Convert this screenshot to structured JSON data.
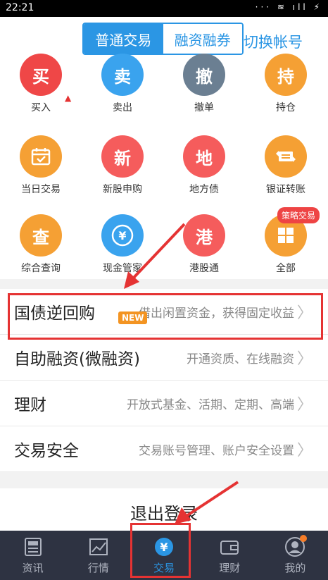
{
  "status_bar": {
    "time": "22:21",
    "icons": "··· ≋ ıll ⚡"
  },
  "header": {
    "tab_normal": "普通交易",
    "tab_margin": "融资融券",
    "switch_account": "切换帐号"
  },
  "grid": {
    "items": [
      {
        "glyph": "买",
        "label": "买入",
        "color": "#ef4747"
      },
      {
        "glyph": "卖",
        "label": "卖出",
        "color": "#3aa3ee"
      },
      {
        "glyph": "撤",
        "label": "撤单",
        "color": "#6b7f92"
      },
      {
        "glyph": "持",
        "label": "持仓",
        "color": "#f5a034"
      },
      {
        "glyph": "calendar",
        "label": "当日交易",
        "color": "#f5a034"
      },
      {
        "glyph": "新",
        "label": "新股申购",
        "color": "#f55c5c"
      },
      {
        "glyph": "地",
        "label": "地方债",
        "color": "#f55c5c"
      },
      {
        "glyph": "transfer",
        "label": "银证转账",
        "color": "#f5a034"
      },
      {
        "glyph": "查",
        "label": "综合查询",
        "color": "#f5a034"
      },
      {
        "glyph": "yen",
        "label": "现金管家",
        "color": "#3aa3ee"
      },
      {
        "glyph": "港",
        "label": "港股通",
        "color": "#f55c5c"
      },
      {
        "glyph": "all",
        "label": "全部",
        "color": "#f5a034"
      }
    ],
    "strategy_badge": "策略交易"
  },
  "list": {
    "rows": [
      {
        "title": "国债逆回购",
        "desc": "借出闲置资金，获得固定收益",
        "badge": "NEW"
      },
      {
        "title": "自助融资(微融资)",
        "desc": "开通资质、在线融资"
      },
      {
        "title": "理财",
        "desc": "开放式基金、活期、定期、高端"
      },
      {
        "title": "交易安全",
        "desc": "交易账号管理、账户安全设置"
      }
    ]
  },
  "logout": "退出登录",
  "tabbar": {
    "tabs": [
      {
        "label": "资讯",
        "icon": "news-icon"
      },
      {
        "label": "行情",
        "icon": "chart-icon"
      },
      {
        "label": "交易",
        "icon": "yen-icon",
        "active": true
      },
      {
        "label": "理财",
        "icon": "wallet-icon"
      },
      {
        "label": "我的",
        "icon": "user-icon"
      }
    ]
  },
  "colors": {
    "accent": "#2b96e4",
    "tabbar_bg": "#2e3342",
    "annotation_red": "#e53333"
  }
}
